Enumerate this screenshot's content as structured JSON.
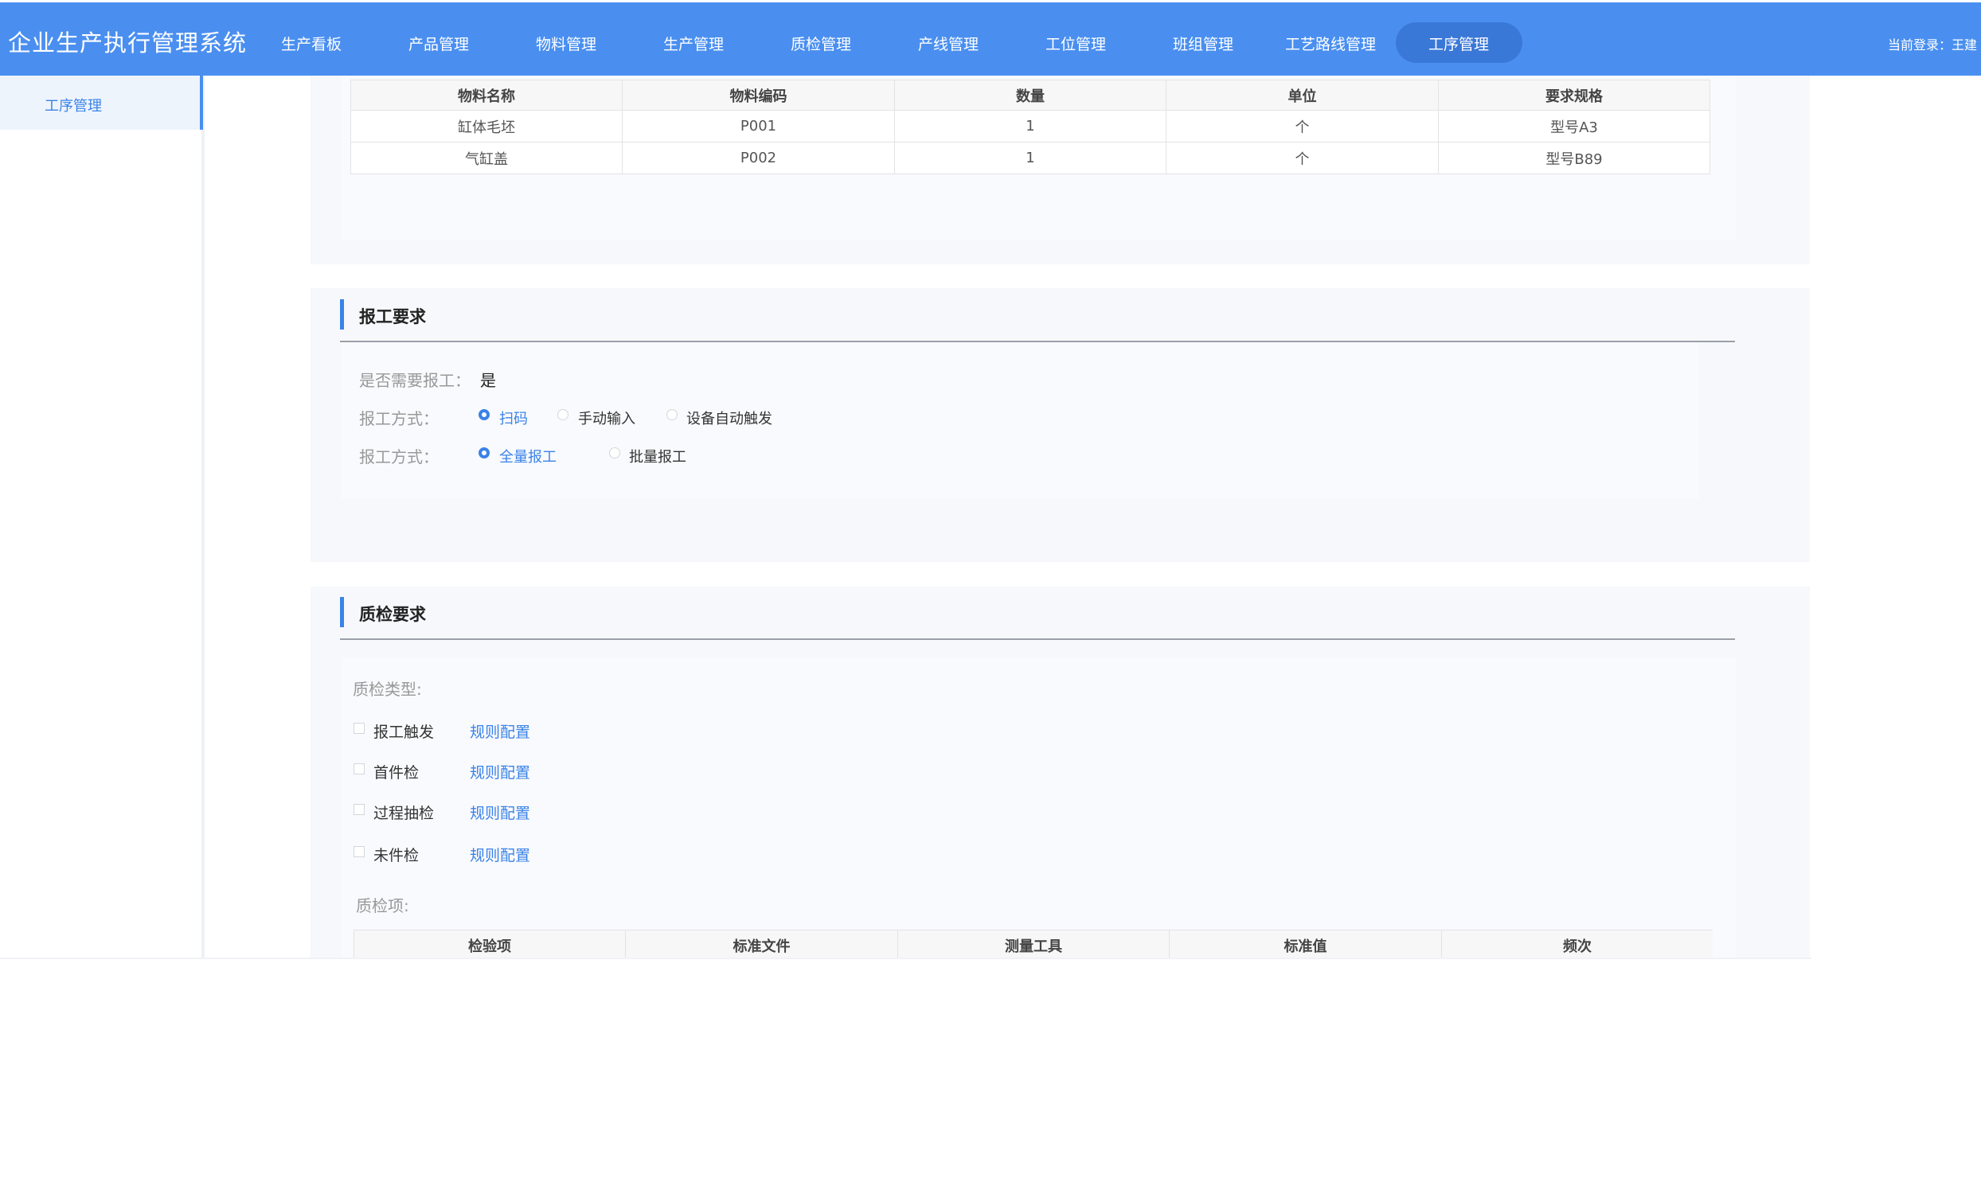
{
  "header": {
    "app_title": "企业生产执行管理系统",
    "nav": [
      "生产看板",
      "产品管理",
      "物料管理",
      "生产管理",
      "质检管理",
      "产线管理",
      "工位管理",
      "班组管理",
      "工艺路线管理",
      "工序管理"
    ],
    "active_nav": "工序管理",
    "user_label": "当前登录：王建"
  },
  "sidebar": {
    "items": [
      {
        "label": "工序管理",
        "active": true
      }
    ]
  },
  "materials_table": {
    "columns": [
      "物料名称",
      "物料编码",
      "数量",
      "单位",
      "要求规格"
    ],
    "rows": [
      [
        "缸体毛坯",
        "P001",
        "1",
        "个",
        "型号A3"
      ],
      [
        "气缸盖",
        "P002",
        "1",
        "个",
        "型号B89"
      ]
    ]
  },
  "report_section": {
    "title": "报工要求",
    "need_report_label": "是否需要报工：",
    "need_report_value": "是",
    "method_label": "报工方式：",
    "method_options": [
      "扫码",
      "手动输入",
      "设备自动触发"
    ],
    "method_selected": "扫码",
    "mode_label": "报工方式：",
    "mode_options": [
      "全量报工",
      "批量报工"
    ],
    "mode_selected": "全量报工"
  },
  "qc_section": {
    "title": "质检要求",
    "type_label": "质检类型:",
    "types": [
      {
        "label": "报工触发",
        "link": "规则配置",
        "checked": false
      },
      {
        "label": "首件检",
        "link": "规则配置",
        "checked": false
      },
      {
        "label": "过程抽检",
        "link": "规则配置",
        "checked": false
      },
      {
        "label": "未件检",
        "link": "规则配置",
        "checked": false
      }
    ],
    "items_label": "质检项:",
    "items_columns": [
      "检验项",
      "标准文件",
      "测量工具",
      "标准值",
      "频次"
    ]
  },
  "colors": {
    "primary": "#4a8ff0",
    "accent": "#3a83e8",
    "panel_bg": "#f6f8fb"
  }
}
